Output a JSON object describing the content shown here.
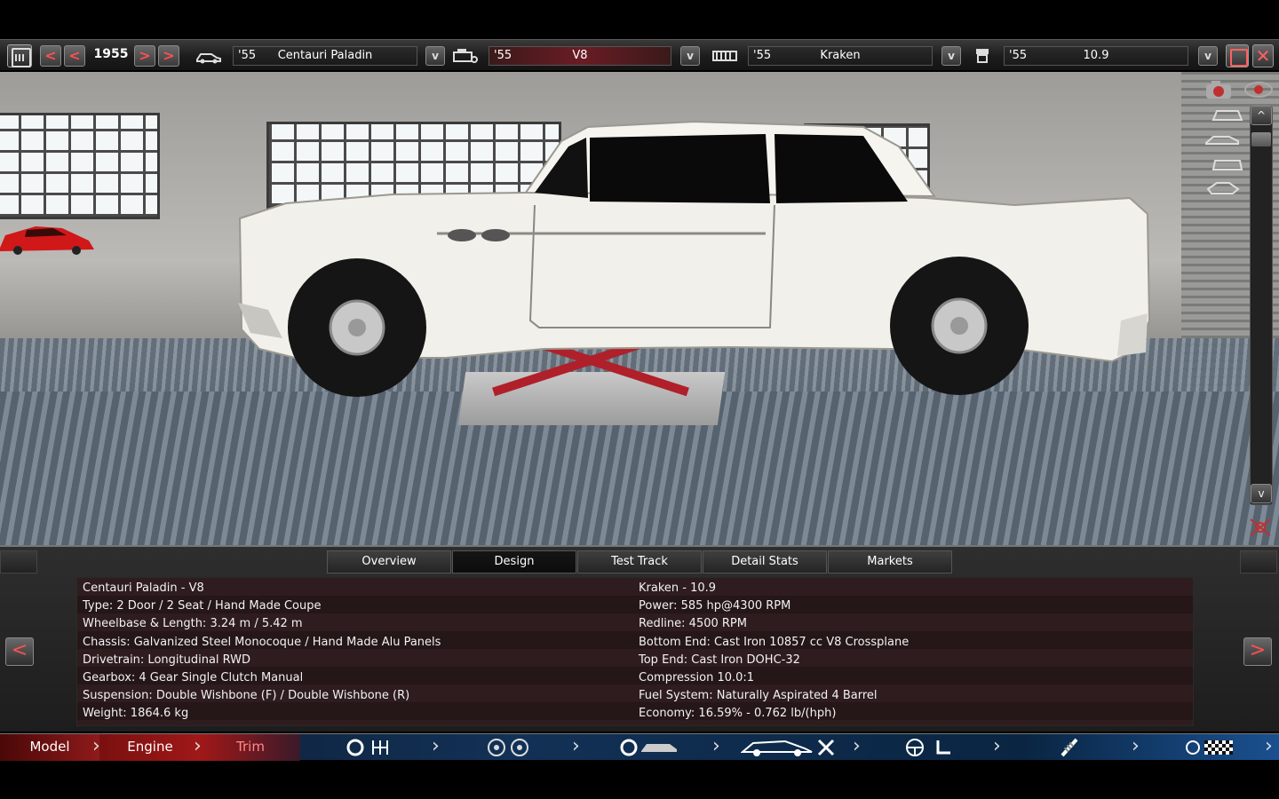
{
  "toolbar": {
    "year": "1955",
    "prev_fast": "<",
    "prev": "<",
    "next": ">",
    "next_fast": ">",
    "model_selector": {
      "year": "'55",
      "name": "Centauri Paladin"
    },
    "engine_selector": {
      "year": "'55",
      "name": "V8"
    },
    "trim_selector": {
      "year": "'55",
      "name": "Kraken"
    },
    "tune_selector": {
      "year": "'55",
      "name": "10.9"
    },
    "dropdown_glyph": "v",
    "close_glyph": "✕"
  },
  "viewport": {
    "scroll_up": "^",
    "scroll_down": "v"
  },
  "tabs": [
    "Overview",
    "Design",
    "Test Track",
    "Detail Stats",
    "Markets"
  ],
  "active_tab": "Design",
  "info": {
    "left": [
      "Centauri Paladin - V8",
      "Type: 2 Door / 2 Seat / Hand Made Coupe",
      "Wheelbase & Length: 3.24 m / 5.42 m",
      "Chassis: Galvanized Steel Monocoque / Hand Made Alu Panels",
      "Drivetrain: Longitudinal RWD",
      "Gearbox: 4 Gear Single Clutch Manual",
      "Suspension: Double Wishbone (F) / Double Wishbone (R)",
      "Weight: 1864.6 kg"
    ],
    "right": [
      "Kraken - 10.9",
      "Power: 585 hp@4300 RPM",
      "Redline: 4500 RPM",
      "Bottom End: Cast Iron 10857 cc V8 Crossplane",
      "Top End: Cast Iron DOHC-32",
      "Compression 10.0:1",
      "Fuel System: Naturally Aspirated 4 Barrel",
      "Economy: 16.59% - 0.762 lb/(hph)"
    ],
    "prev": "<",
    "next": ">"
  },
  "nav": {
    "model": "Model",
    "engine": "Engine",
    "trim": "Trim"
  },
  "colors": {
    "accent_red": "#a01818",
    "car_body": "#f2f0ea",
    "nav_blue": "#123156"
  }
}
